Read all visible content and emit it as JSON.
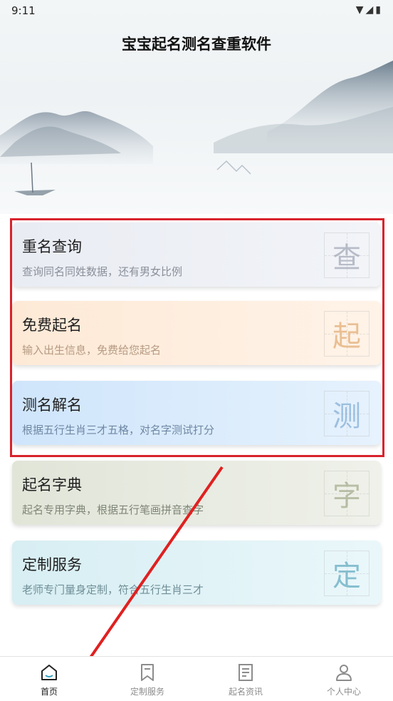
{
  "status_bar": {
    "time": "9:11",
    "icons": [
      "wifi-icon",
      "signal-icon",
      "battery-icon"
    ]
  },
  "app_title": "宝宝起名测名查重软件",
  "cards": [
    {
      "title": "重名查询",
      "desc": "查询同名同姓数据，还有男女比例",
      "glyph": "查"
    },
    {
      "title": "免费起名",
      "desc": "输入出生信息，免费给您起名",
      "glyph": "起"
    },
    {
      "title": "测名解名",
      "desc": "根据五行生肖三才五格，对名字测试打分",
      "glyph": "测"
    },
    {
      "title": "起名字典",
      "desc": "起名专用字典，根据五行笔画拼音查字",
      "glyph": "字"
    },
    {
      "title": "定制服务",
      "desc": "老师专门量身定制，符合五行生肖三才",
      "glyph": "定"
    }
  ],
  "bottom_nav": [
    {
      "label": "首页",
      "icon": "home-icon",
      "active": true
    },
    {
      "label": "定制服务",
      "icon": "bookmark-icon",
      "active": false
    },
    {
      "label": "起名资讯",
      "icon": "news-icon",
      "active": false
    },
    {
      "label": "个人中心",
      "icon": "user-icon",
      "active": false
    }
  ],
  "colors": {
    "highlight_box": "#d8232c",
    "arrow": "#e02020"
  }
}
